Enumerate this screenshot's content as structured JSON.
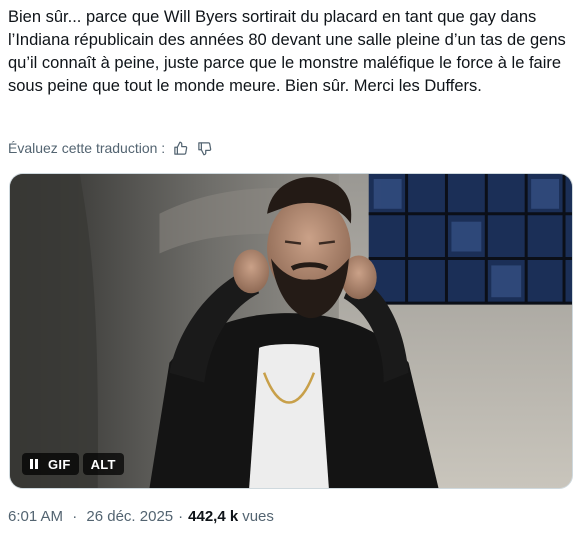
{
  "tweet": {
    "text": "Bien sûr... parce que Will Byers sortirait du placard en tant que gay dans l’Indiana républicain des années 80 devant une salle pleine d’un tas de gens qu’il connaît à peine, juste parce que le monstre maléfique le force à le faire sous peine que tout le monde meure. Bien sûr. Merci les Duffers."
  },
  "translation": {
    "rate_label": "Évaluez cette traduction :",
    "thumb_up_icon": "thumb-up-icon",
    "thumb_down_icon": "thumb-down-icon"
  },
  "media": {
    "type": "gif",
    "gif_label": "GIF",
    "alt_label": "ALT",
    "pause_icon": "pause-icon"
  },
  "meta": {
    "time": "6:01 AM",
    "date": "26 déc. 2025",
    "separator": "·",
    "views_count": "442,4 k",
    "views_label": "vues"
  },
  "colors": {
    "text_primary": "#0f1419",
    "text_secondary": "#536471",
    "border": "#cfd9de"
  }
}
